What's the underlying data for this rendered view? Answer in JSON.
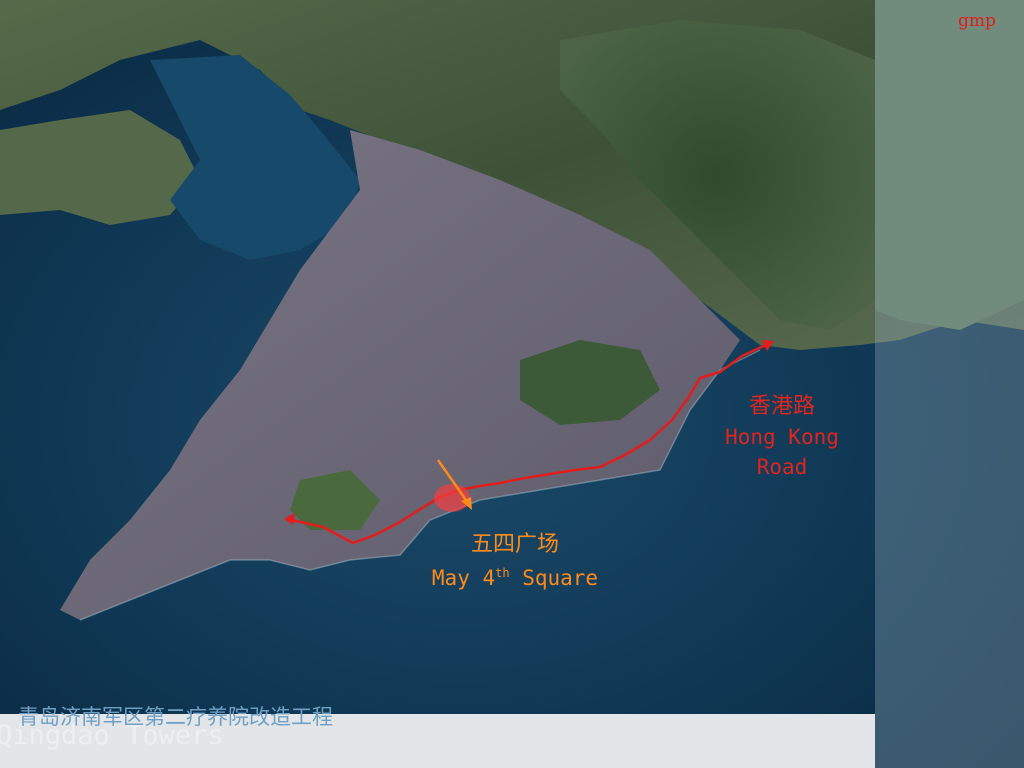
{
  "corner_tag": "gmp",
  "hong_kong_road": {
    "zh": "香港路",
    "en_line1": "Hong Kong",
    "en_line2": "Road"
  },
  "may_fourth_square": {
    "zh": "五四广场",
    "en_prefix": "May 4",
    "en_sup": "th",
    "en_suffix": " Square"
  },
  "project_title": "青岛济南军区第二疗养院改造工程",
  "watermark": "Qingdao Towers",
  "colors": {
    "sea": "#0d3552",
    "land": "#4a5a44",
    "city": "#6d6878",
    "route": "#e31c1c",
    "square_marker": "#ff8a1a"
  }
}
